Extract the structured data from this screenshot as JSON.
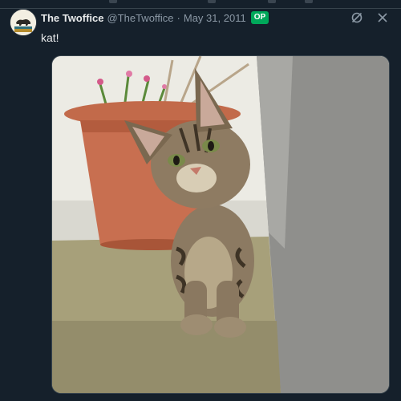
{
  "tweet": {
    "display_name": "The Twoffice",
    "handle": "@TheTwoffice",
    "separator": "·",
    "date": "May 31, 2011",
    "badge": "OP",
    "text": "kat!",
    "avatar_icon": "bear-flag-icon",
    "media_alt": "kitten-photo",
    "actions": [
      {
        "name": "grok-icon"
      },
      {
        "name": "close-icon"
      }
    ]
  },
  "colors": {
    "background": "#15202b",
    "text_primary": "#e7e9ea",
    "text_secondary": "#8b98a5",
    "badge": "#00a85a",
    "divider": "#38444d"
  }
}
